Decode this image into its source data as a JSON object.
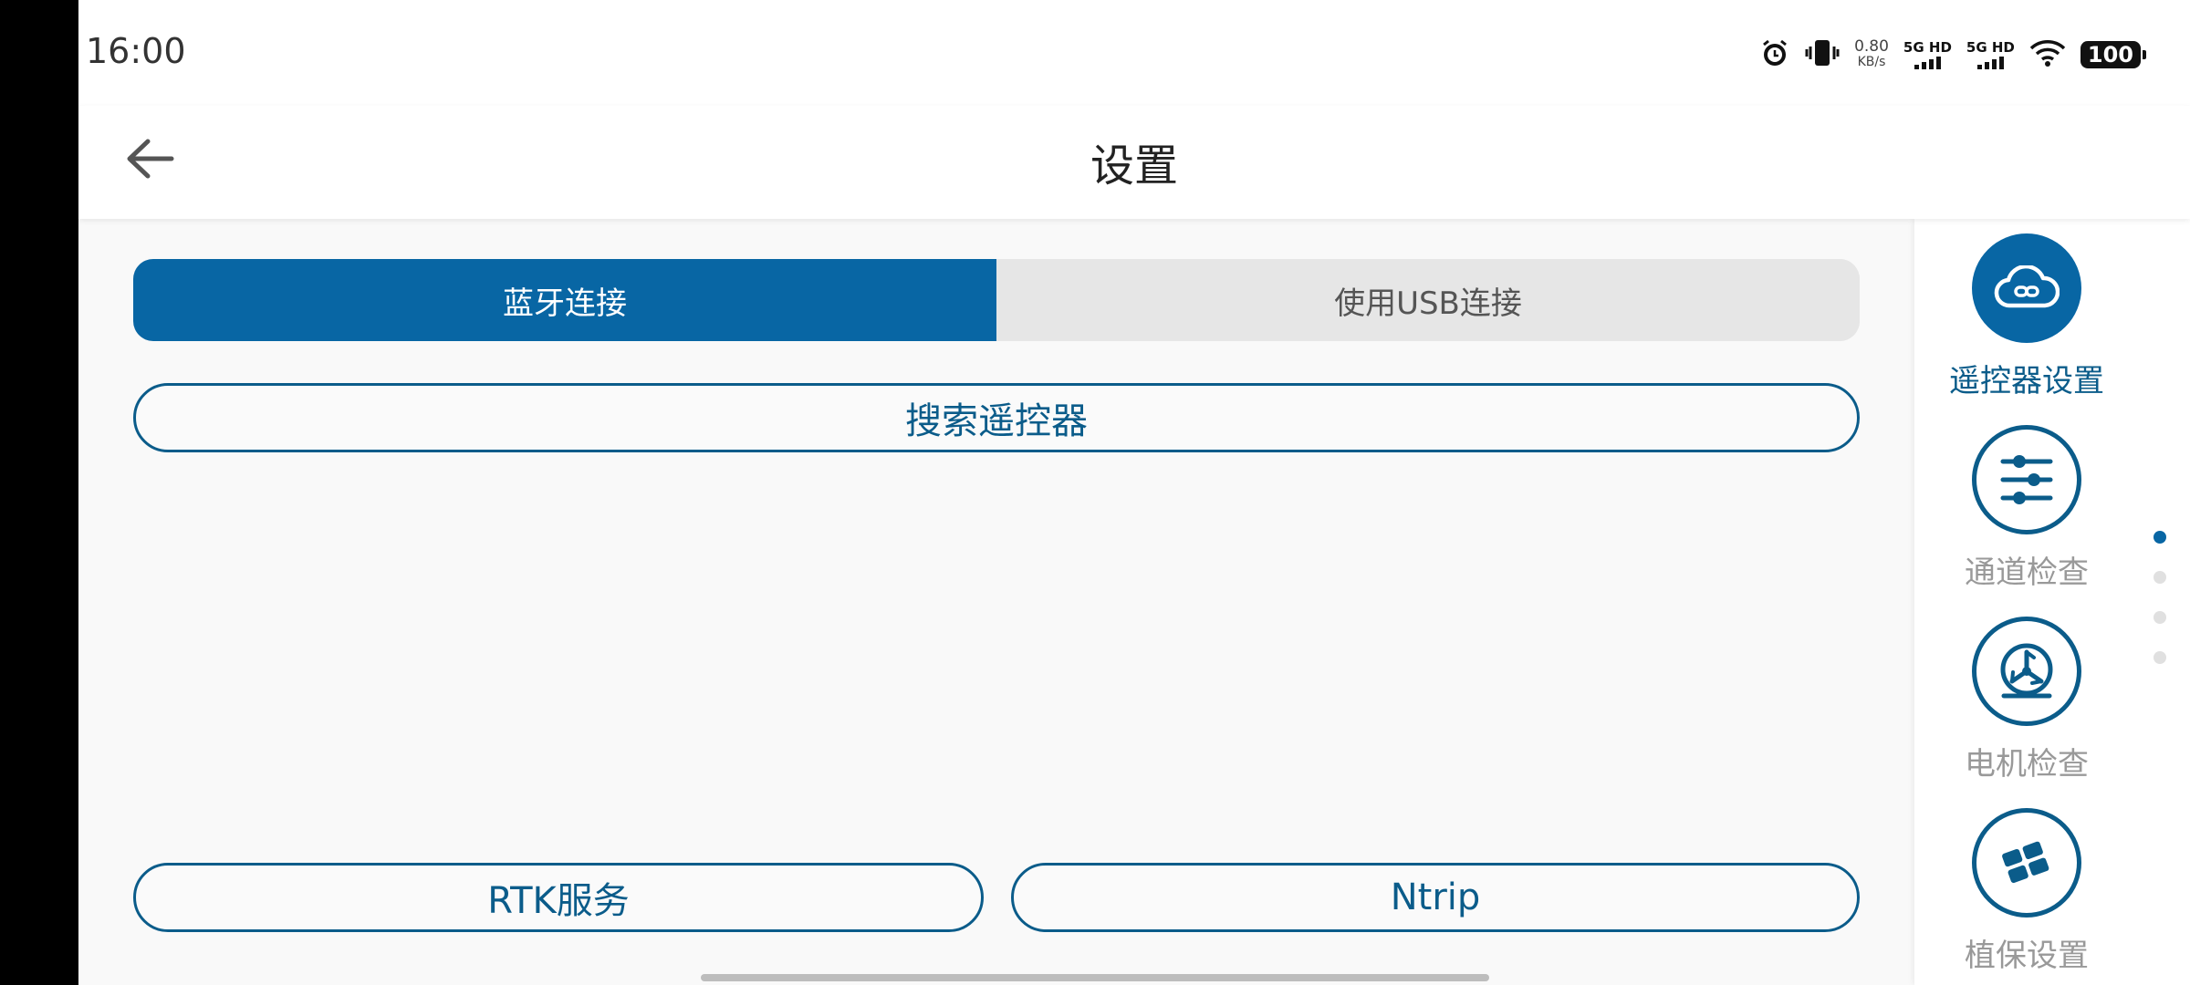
{
  "status_bar": {
    "time": "16:00",
    "net_speed_value": "0.80",
    "net_speed_unit": "KB/s",
    "sim1_label": "5G HD",
    "sim2_label": "5G HD",
    "battery": "100",
    "icons": [
      "alarm-icon",
      "vibrate-icon",
      "signal-icon",
      "signal-icon",
      "wifi-icon",
      "battery-icon"
    ]
  },
  "header": {
    "title": "设置",
    "back_icon": "arrow-left-icon"
  },
  "connection_tabs": [
    {
      "label": "蓝牙连接",
      "active": true
    },
    {
      "label": "使用USB连接",
      "active": false
    }
  ],
  "buttons": {
    "search": "搜索遥控器",
    "rtk": "RTK服务",
    "ntrip": "Ntrip"
  },
  "sidebar": {
    "items": [
      {
        "label": "遥控器设置",
        "icon": "cloud-link-icon",
        "active": true
      },
      {
        "label": "通道检查",
        "icon": "sliders-icon",
        "active": false
      },
      {
        "label": "电机检查",
        "icon": "motor-gauge-icon",
        "active": false
      },
      {
        "label": "植保设置",
        "icon": "field-grid-icon",
        "active": false
      }
    ],
    "page_dots": 4,
    "active_dot": 1
  },
  "colors": {
    "accent": "#0866a4",
    "outline": "#0b5c8a",
    "inactive_tab": "#e6e6e6",
    "background": "#f9f9f9"
  }
}
